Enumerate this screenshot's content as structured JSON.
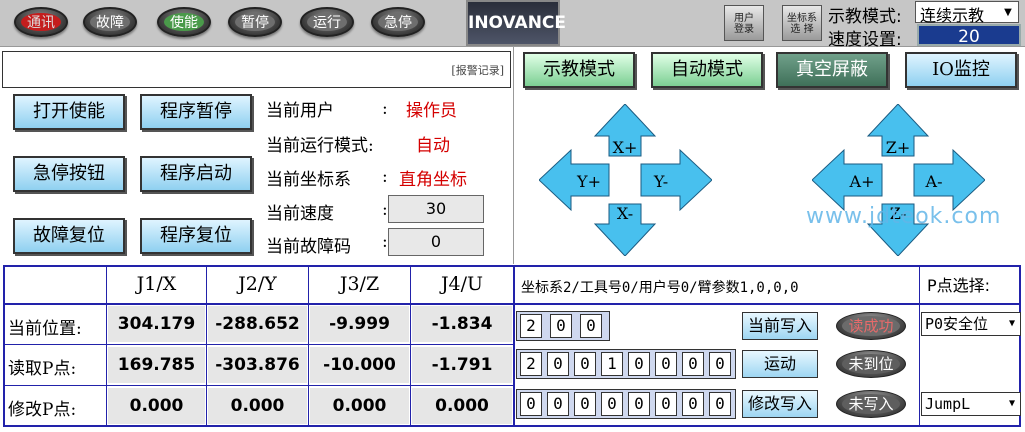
{
  "toolbar": {
    "lamps": [
      "通讯",
      "故障",
      "使能",
      "暂停",
      "运行",
      "急停"
    ],
    "logo": "INOVANCE",
    "user_login": [
      "用户",
      "登录"
    ],
    "coord_select": [
      "坐标系",
      "选 择"
    ],
    "teach_mode_label": "示教模式:",
    "teach_mode_value": "连续示教",
    "speed_label": "速度设置:",
    "speed_value": "20"
  },
  "alarm": {
    "link": "[报警记录]"
  },
  "controls": {
    "enable": "打开使能",
    "pause": "程序暂停",
    "estop": "急停按钮",
    "start": "程序启动",
    "fault_reset": "故障复位",
    "prog_reset": "程序复位"
  },
  "status": {
    "user_label": "当前用户",
    "user_value": "操作员",
    "mode_label": "当前运行模式:",
    "mode_value": "自动",
    "coord_label": "当前坐标系",
    "coord_value": "直角坐标",
    "speed_label": "当前速度",
    "speed_value": "30",
    "fault_label": "当前故障码",
    "fault_value": "0",
    "colon": ":"
  },
  "modes": {
    "teach": "示教模式",
    "auto": "自动模式",
    "vacuum": "真空屏蔽",
    "io": "IO监控"
  },
  "jog": {
    "xp": "X+",
    "xm": "X-",
    "yp": "Y+",
    "ym": "Y-",
    "zp": "Z+",
    "zm": "Z-",
    "ap": "A+",
    "am": "A-"
  },
  "watermark": "www.jdteok.com",
  "table": {
    "headers": [
      "J1/X",
      "J2/Y",
      "J3/Z",
      "J4/U"
    ],
    "rows": [
      {
        "label": "当前位置:",
        "values": [
          "304.179",
          "-288.652",
          "-9.999",
          "-1.834"
        ]
      },
      {
        "label": "读取P点:",
        "values": [
          "169.785",
          "-303.876",
          "-10.000",
          "-1.791"
        ]
      },
      {
        "label": "修改P点:",
        "values": [
          "0.000",
          "0.000",
          "0.000",
          "0.000"
        ]
      }
    ],
    "coord_info": "坐标系2/工具号0/用户号0/臂参数1,0,0,0",
    "row_digits": [
      [
        "2",
        "0",
        "0"
      ],
      [
        "2",
        "0",
        "0",
        "1",
        "0",
        "0",
        "0",
        "0"
      ],
      [
        "0",
        "0",
        "0",
        "0",
        "0",
        "0",
        "0",
        "0"
      ]
    ],
    "row_buttons": [
      "当前写入",
      "运动",
      "修改写入"
    ],
    "row_status": [
      "读成功",
      "未到位",
      "未写入"
    ],
    "p_select_label": "P点选择:",
    "p_select_value": "P0安全位",
    "motion_type": "JumpL"
  }
}
